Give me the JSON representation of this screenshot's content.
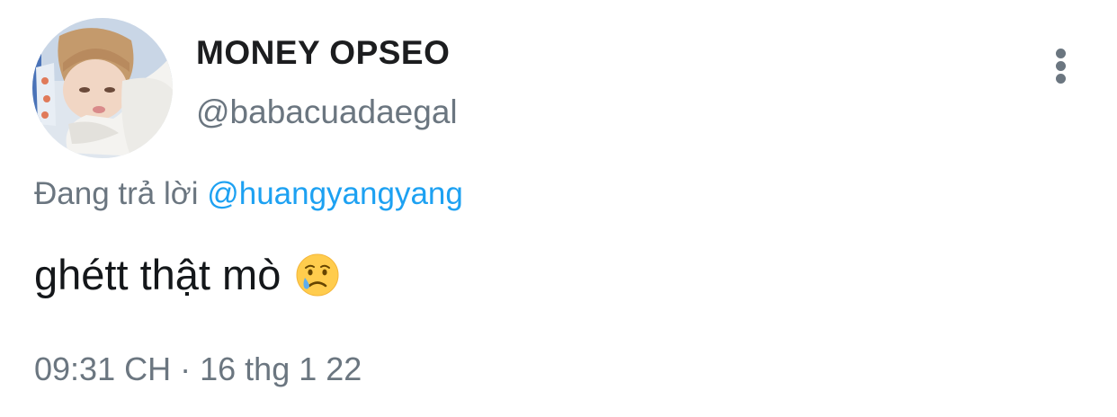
{
  "user": {
    "display_name": "MONEY OPSEO",
    "handle": "@babacuadaegal",
    "avatar_icon": "profile-photo"
  },
  "reply": {
    "prefix": "Đang trả lời",
    "mention": "@huangyangyang"
  },
  "tweet": {
    "text": "ghétt thật mò",
    "emoji": "crying-face-emoji"
  },
  "meta": {
    "time": "09:31 CH",
    "separator": "·",
    "date": "16 thg 1 22"
  },
  "menu": {
    "icon": "more-vertical-icon"
  },
  "colors": {
    "link": "#1da1f2",
    "secondary_text": "#6b7680",
    "primary_text": "#14171a"
  }
}
